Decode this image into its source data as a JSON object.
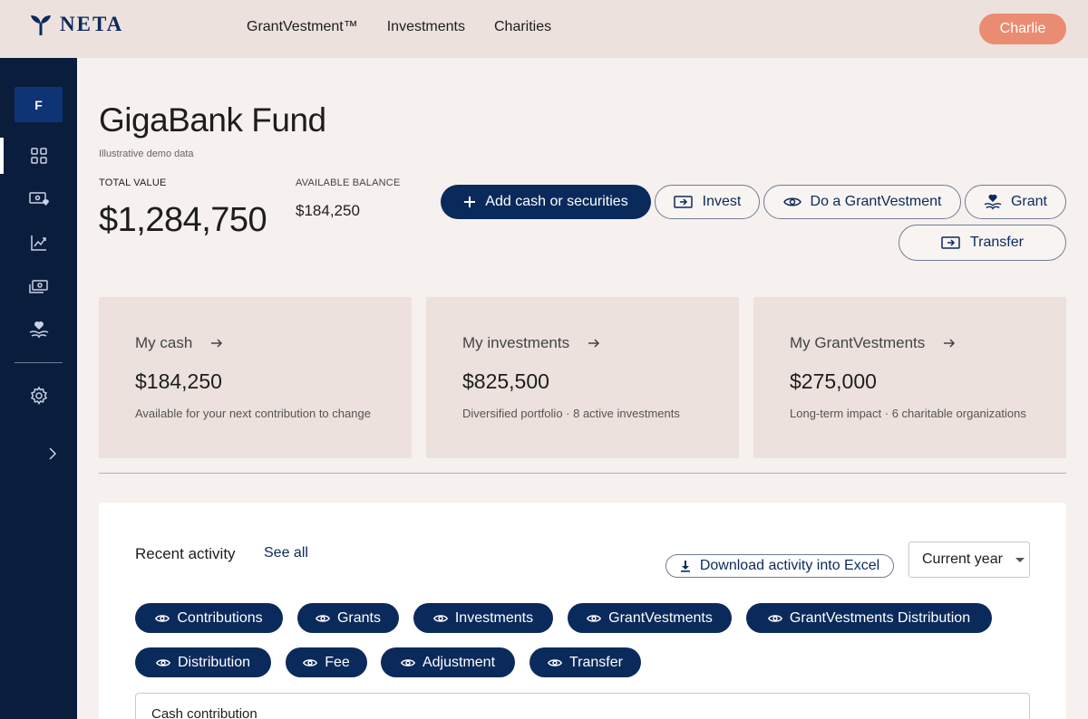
{
  "app": {
    "logo_text": "NETA",
    "nav": [
      "GrantVestment™",
      "Investments",
      "Charities"
    ],
    "user_name": "Charlie"
  },
  "sidebar": {
    "fund_initial": "F",
    "items": [
      {
        "icon": "dashboard-grid-icon"
      },
      {
        "icon": "cash-heart-icon"
      },
      {
        "icon": "chart-line-icon"
      },
      {
        "icon": "transfer-icon"
      },
      {
        "icon": "hand-heart-icon"
      },
      {
        "icon": "gear-icon"
      },
      {
        "icon": "chevron-right-icon"
      }
    ]
  },
  "fund": {
    "title": "GigaBank Fund",
    "note": "Illustrative demo data",
    "total_value_label": "TOTAL VALUE",
    "total_value": "$1,284,750",
    "available_balance_label": "AVAILABLE BALANCE",
    "available_balance": "$184,250"
  },
  "actions": {
    "add_cash": "Add cash or securities",
    "invest": "Invest",
    "grantvestment": "Do a GrantVestment",
    "grant": "Grant",
    "transfer": "Transfer"
  },
  "cards": [
    {
      "title": "My cash",
      "value": "$184,250",
      "sub": "Available for your next contribution to change"
    },
    {
      "title": "My investments",
      "value": "$825,500",
      "sub": "Diversified portfolio · 8 active investments"
    },
    {
      "title": "My GrantVestments",
      "value": "$275,000",
      "sub": "Long-term impact · 6 charitable organizations"
    }
  ],
  "activity": {
    "title": "Recent activity",
    "see_all": "See all",
    "download": "Download activity into Excel",
    "period": "Current year",
    "filters": [
      "Contributions",
      "Grants",
      "Investments",
      "GrantVestments",
      "GrantVestments Distribution",
      "Distribution",
      "Fee",
      "Adjustment",
      "Transfer"
    ],
    "first_row_label": "Cash contribution"
  },
  "colors": {
    "navy": "#0b2a5c",
    "sidebar": "#0b1d3d",
    "accent": "#ea8c72",
    "topbar": "#ece1dc"
  }
}
